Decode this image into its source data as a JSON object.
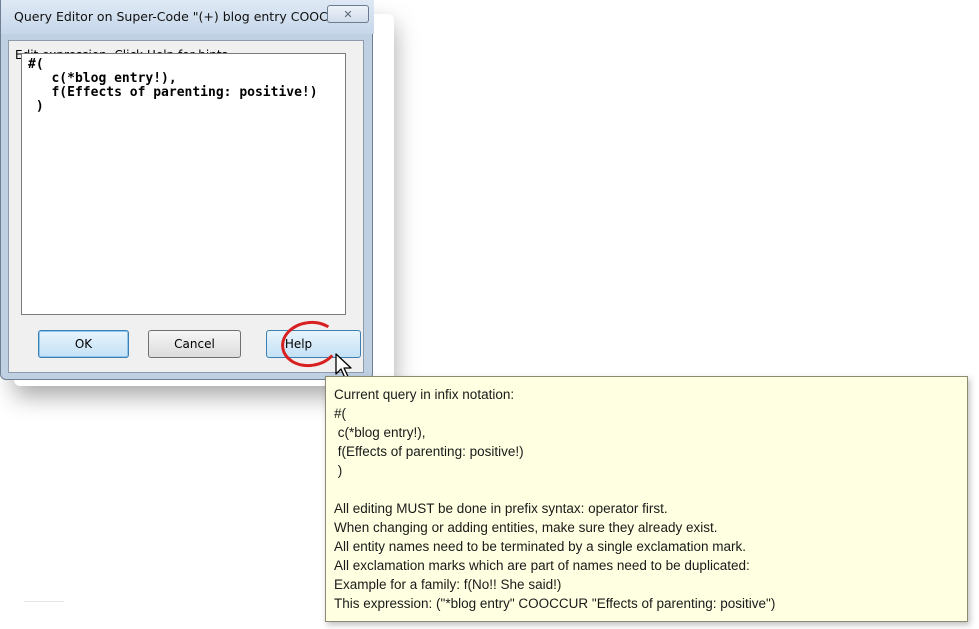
{
  "window": {
    "title": "Query Editor on Super-Code \"(+) blog entry COOCCUR Effects of parenting: posit...",
    "close_glyph": "✕"
  },
  "dialog": {
    "prompt": "Edit expression. Click Help for hints.",
    "expression_lines": [
      "#(",
      "   c(*blog entry!),",
      "   f(Effects of parenting: positive!)",
      " )"
    ]
  },
  "buttons": {
    "ok": "OK",
    "cancel": "Cancel",
    "help": "Help"
  },
  "tooltip": {
    "header": "Current query in infix notation:",
    "infix_lines": [
      "#(",
      " c(*blog entry!),",
      " f(Effects of parenting: positive!)",
      " )"
    ],
    "hints": [
      "All editing MUST be done in prefix syntax: operator first.",
      "When changing or adding entities, make sure they already exist.",
      "All entity names need to be terminated by a single exclamation mark.",
      "All exclamation marks which are part of names need to be duplicated:",
      "Example for a family: f(No!! She said!)",
      "This expression: (\"*blog entry\" COOCCUR \"Effects of parenting: positive\")"
    ]
  },
  "colors": {
    "annotation_circle": "#d82020",
    "tooltip_bg": "#ffffe1",
    "accent_button": "#c4e1f6"
  }
}
